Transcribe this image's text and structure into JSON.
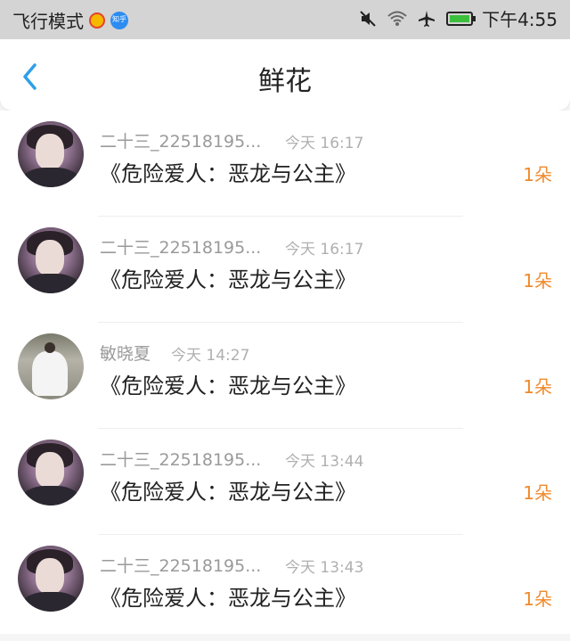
{
  "status_bar": {
    "left_text": "飞行模式",
    "zhihu_badge": "知乎",
    "time": "下午4:55",
    "icons": [
      "weibo-icon",
      "zhihu-icon",
      "mute-icon",
      "wifi-icon",
      "airplane-icon",
      "battery-icon"
    ]
  },
  "nav": {
    "title": "鲜花",
    "back_icon": "chevron-left-icon"
  },
  "colors": {
    "accent_blue": "#2f9fe8",
    "count_orange": "#f08a2c",
    "battery_green": "#3cbf3c"
  },
  "items": [
    {
      "sender": "二十三_22518195...",
      "time": "今天 16:17",
      "title": "《危险爱人：恶龙与公主》",
      "count": "1朵",
      "avatar": "avatar-boy"
    },
    {
      "sender": "二十三_22518195...",
      "time": "今天 16:17",
      "title": "《危险爱人：恶龙与公主》",
      "count": "1朵",
      "avatar": "avatar-boy"
    },
    {
      "sender": "敏晓夏",
      "time": "今天 14:27",
      "title": "《危险爱人：恶龙与公主》",
      "count": "1朵",
      "avatar": "avatar-bride"
    },
    {
      "sender": "二十三_22518195...",
      "time": "今天 13:44",
      "title": "《危险爱人：恶龙与公主》",
      "count": "1朵",
      "avatar": "avatar-boy"
    },
    {
      "sender": "二十三_22518195...",
      "time": "今天 13:43",
      "title": "《危险爱人：恶龙与公主》",
      "count": "1朵",
      "avatar": "avatar-boy"
    }
  ]
}
